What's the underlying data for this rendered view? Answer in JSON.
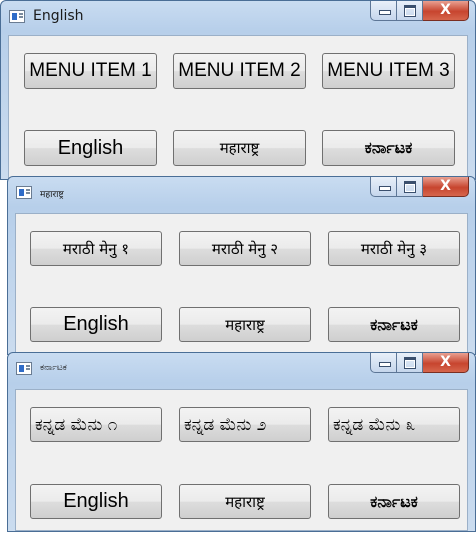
{
  "windows": [
    {
      "title": "English",
      "menu_buttons": [
        "MENU ITEM 1",
        "MENU ITEM 2",
        "MENU ITEM 3"
      ],
      "lang_buttons": [
        "English",
        "महाराष्ट्र",
        "ಕರ್ನಾಟಕ"
      ]
    },
    {
      "title": "महाराष्ट्र",
      "menu_buttons": [
        "मराठी मेनु १",
        "मराठी मेनु २",
        "मराठी मेनु ३"
      ],
      "lang_buttons": [
        "English",
        "महाराष्ट्र",
        "ಕರ್ನಾಟಕ"
      ]
    },
    {
      "title": "ಕರ್ನಾಟಕ",
      "menu_buttons": [
        "ಕನ್ನಡ ಮೆನು ೧",
        "ಕನ್ನಡ ಮೆನು ೨",
        "ಕನ್ನಡ ಮೆನು ೩"
      ],
      "lang_buttons": [
        "English",
        "महाराष्ट्र",
        "ಕರ್ನಾಟಕ"
      ]
    }
  ],
  "caption_buttons": {
    "close": "X"
  },
  "icons": [
    "app-window-icon",
    "minimize-icon",
    "maximize-icon",
    "close-icon"
  ]
}
